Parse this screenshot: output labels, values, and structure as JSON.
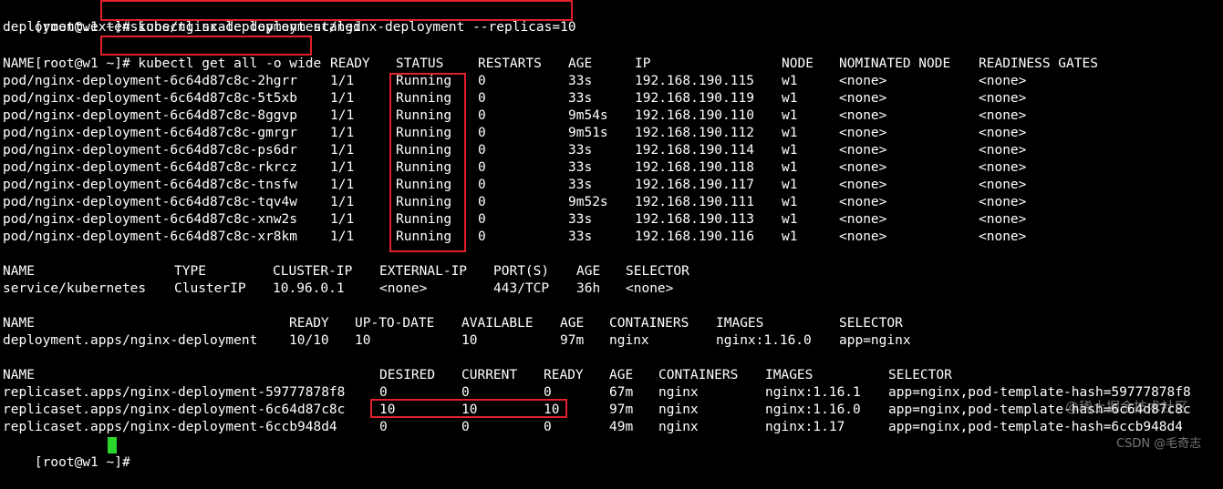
{
  "prompt": "[root@w1 ~]#",
  "cmd1": "kubectl scale deployment/nginx-deployment --replicas=10",
  "out1": "deployment.extensions/nginx-deployment scaled",
  "cmd2": "kubectl get all -o wide",
  "pods_header": [
    "NAME",
    "READY",
    "STATUS",
    "RESTARTS",
    "AGE",
    "IP",
    "NODE",
    "NOMINATED NODE",
    "READINESS GATES"
  ],
  "pods": [
    [
      "pod/nginx-deployment-6c64d87c8c-2hgrr",
      "1/1",
      "Running",
      "0",
      "33s",
      "192.168.190.115",
      "w1",
      "<none>",
      "<none>"
    ],
    [
      "pod/nginx-deployment-6c64d87c8c-5t5xb",
      "1/1",
      "Running",
      "0",
      "33s",
      "192.168.190.119",
      "w1",
      "<none>",
      "<none>"
    ],
    [
      "pod/nginx-deployment-6c64d87c8c-8ggvp",
      "1/1",
      "Running",
      "0",
      "9m54s",
      "192.168.190.110",
      "w1",
      "<none>",
      "<none>"
    ],
    [
      "pod/nginx-deployment-6c64d87c8c-gmrgr",
      "1/1",
      "Running",
      "0",
      "9m51s",
      "192.168.190.112",
      "w1",
      "<none>",
      "<none>"
    ],
    [
      "pod/nginx-deployment-6c64d87c8c-ps6dr",
      "1/1",
      "Running",
      "0",
      "33s",
      "192.168.190.114",
      "w1",
      "<none>",
      "<none>"
    ],
    [
      "pod/nginx-deployment-6c64d87c8c-rkrcz",
      "1/1",
      "Running",
      "0",
      "33s",
      "192.168.190.118",
      "w1",
      "<none>",
      "<none>"
    ],
    [
      "pod/nginx-deployment-6c64d87c8c-tnsfw",
      "1/1",
      "Running",
      "0",
      "33s",
      "192.168.190.117",
      "w1",
      "<none>",
      "<none>"
    ],
    [
      "pod/nginx-deployment-6c64d87c8c-tqv4w",
      "1/1",
      "Running",
      "0",
      "9m52s",
      "192.168.190.111",
      "w1",
      "<none>",
      "<none>"
    ],
    [
      "pod/nginx-deployment-6c64d87c8c-xnw2s",
      "1/1",
      "Running",
      "0",
      "33s",
      "192.168.190.113",
      "w1",
      "<none>",
      "<none>"
    ],
    [
      "pod/nginx-deployment-6c64d87c8c-xr8km",
      "1/1",
      "Running",
      "0",
      "33s",
      "192.168.190.116",
      "w1",
      "<none>",
      "<none>"
    ]
  ],
  "svc_header": [
    "NAME",
    "TYPE",
    "CLUSTER-IP",
    "EXTERNAL-IP",
    "PORT(S)",
    "AGE",
    "SELECTOR"
  ],
  "svc": [
    [
      "service/kubernetes",
      "ClusterIP",
      "10.96.0.1",
      "<none>",
      "443/TCP",
      "36h",
      "<none>"
    ]
  ],
  "dep_header": [
    "NAME",
    "READY",
    "UP-TO-DATE",
    "AVAILABLE",
    "AGE",
    "CONTAINERS",
    "IMAGES",
    "SELECTOR"
  ],
  "dep": [
    [
      "deployment.apps/nginx-deployment",
      "10/10",
      "10",
      "10",
      "97m",
      "nginx",
      "nginx:1.16.0",
      "app=nginx"
    ]
  ],
  "rs_header": [
    "NAME",
    "DESIRED",
    "CURRENT",
    "READY",
    "AGE",
    "CONTAINERS",
    "IMAGES",
    "SELECTOR"
  ],
  "rs": [
    [
      "replicaset.apps/nginx-deployment-59777878f8",
      "0",
      "0",
      "0",
      "67m",
      "nginx",
      "nginx:1.16.1",
      "app=nginx,pod-template-hash=59777878f8"
    ],
    [
      "replicaset.apps/nginx-deployment-6c64d87c8c",
      "10",
      "10",
      "10",
      "97m",
      "nginx",
      "nginx:1.16.0",
      "app=nginx,pod-template-hash=6c64d87c8c"
    ],
    [
      "replicaset.apps/nginx-deployment-6ccb948d4",
      "0",
      "0",
      "0",
      "49m",
      "nginx",
      "nginx:1.17",
      "app=nginx,pod-template-hash=6ccb948d4"
    ]
  ],
  "watermark1": "@稀土掘金技术社区",
  "watermark2": "CSDN @毛奇志",
  "colors": {
    "background": "#000000",
    "text": "#ffffff",
    "highlight_box": "#e0202a",
    "cursor": "#2bd62b"
  }
}
